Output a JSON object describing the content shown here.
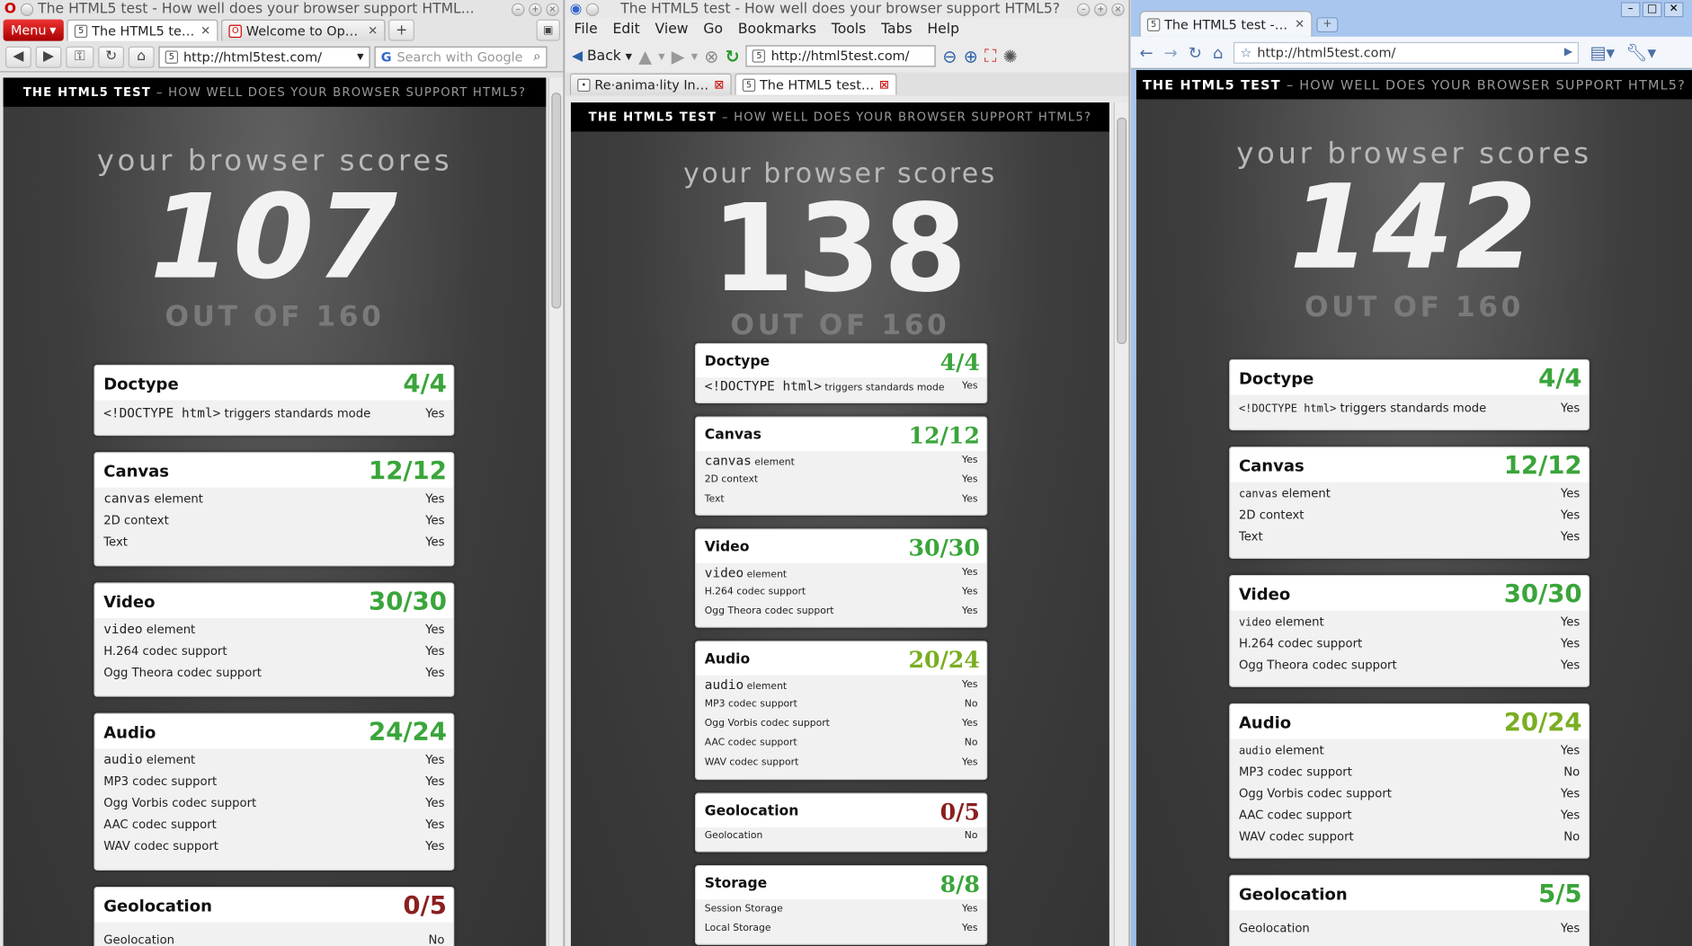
{
  "shared": {
    "header_title": "THE HTML5 TEST",
    "header_sub": "– HOW WELL DOES YOUR BROWSER SUPPORT HTML5?",
    "scores_label": "your browser scores",
    "mp3": "MP3 codec support",
    "vorbis": "Ogg Vorbis codec support",
    "aac": "AAC codec support",
    "wav": "WAV codec support",
    "canvas_el": "canvas",
    "element": "element",
    "ctx2d": "2D context",
    "text": "Text",
    "video_el": "video",
    "h264": "H.264 codec support",
    "theora": "Ogg Theora codec support",
    "audio_el": "audio",
    "geo": "Geolocation",
    "doctype_tag": "<!DOCTYPE html>",
    "doctype_rest": "triggers standards mode",
    "session": "Session Storage",
    "local": "Local Storage"
  },
  "opera": {
    "title": "The HTML5 test - How well does your browser support HTML...",
    "menu_label": "Menu",
    "tab1": "The HTML5 test - ...",
    "tab2": "Welcome to Opera",
    "url": "http://html5test.com/",
    "search_placeholder": "Search with Google",
    "score": "107",
    "outof": "OUT OF 160",
    "cats": {
      "doctype": [
        "Doctype",
        "4/4"
      ],
      "canvas": [
        "Canvas",
        "12/12"
      ],
      "video": [
        "Video",
        "30/30"
      ],
      "audio": [
        "Audio",
        "24/24"
      ],
      "geo": [
        "Geolocation",
        "0/5"
      ]
    },
    "vals": {
      "doctype": "Yes",
      "canvas": "Yes",
      "ctx": "Yes",
      "text": "Yes",
      "video": "Yes",
      "h264": "Yes",
      "theora": "Yes",
      "audio": "Yes",
      "mp3": "Yes",
      "vorbis": "Yes",
      "aac": "Yes",
      "wav": "Yes",
      "geo": "No"
    }
  },
  "konq": {
    "title": "The HTML5 test - How well does your browser support HTML5?",
    "menu": [
      "File",
      "Edit",
      "View",
      "Go",
      "Bookmarks",
      "Tools",
      "Tabs",
      "Help"
    ],
    "back": "Back",
    "url": "http://html5test.com/",
    "tab1": "Re·anima·lity Inc. ...",
    "tab2": "The HTML5 test -...",
    "score": "138",
    "outof": "OUT OF 160",
    "cats": {
      "doctype": [
        "Doctype",
        "4/4"
      ],
      "canvas": [
        "Canvas",
        "12/12"
      ],
      "video": [
        "Video",
        "30/30"
      ],
      "audio": [
        "Audio",
        "20/24"
      ],
      "geo": [
        "Geolocation",
        "0/5"
      ],
      "storage": [
        "Storage",
        "8/8"
      ]
    },
    "vals": {
      "doctype": "Yes",
      "canvas": "Yes",
      "ctx": "Yes",
      "text": "Yes",
      "video": "Yes",
      "h264": "Yes",
      "theora": "Yes",
      "audio": "Yes",
      "mp3": "No",
      "vorbis": "Yes",
      "aac": "No",
      "wav": "Yes",
      "geo": "No",
      "session": "Yes",
      "local": "Yes"
    }
  },
  "chrome": {
    "tab1": "The HTML5 test - Ho...",
    "url": "http://html5test.com/",
    "score": "142",
    "outof": "OUT OF 160",
    "cats": {
      "doctype": [
        "Doctype",
        "4/4"
      ],
      "canvas": [
        "Canvas",
        "12/12"
      ],
      "video": [
        "Video",
        "30/30"
      ],
      "audio": [
        "Audio",
        "20/24"
      ],
      "geo": [
        "Geolocation",
        "5/5"
      ]
    },
    "vals": {
      "doctype": "Yes",
      "canvas": "Yes",
      "ctx": "Yes",
      "text": "Yes",
      "video": "Yes",
      "h264": "Yes",
      "theora": "Yes",
      "audio": "Yes",
      "mp3": "No",
      "vorbis": "Yes",
      "aac": "Yes",
      "wav": "No",
      "geo": "Yes"
    }
  }
}
